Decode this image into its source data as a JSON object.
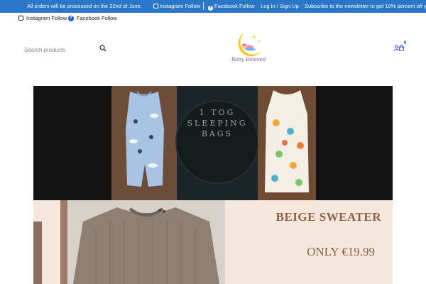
{
  "topbar": {
    "notice": "All orders will be processed on the 22nd of June.",
    "instagram_label": "Instagram Follow",
    "facebook_label": "Facebook Follow",
    "account_link": "Log In / Sign Up",
    "newsletter": "Subscribe to the newsletter to get 10% percent off yo",
    "bg_color": "#2a77c9"
  },
  "social": {
    "instagram_label": "Instagram Follow",
    "facebook_label": "Facebook Follow"
  },
  "header": {
    "search_placeholder": "Search products",
    "logo_text": "Baby Beloved",
    "cart_count": "0",
    "icons": [
      "search-icon",
      "user-icon",
      "cart-icon"
    ]
  },
  "banner_tog": {
    "lines": [
      "1 TOG",
      "SLEEPING",
      "BAGS"
    ]
  },
  "banner_sweater": {
    "title": "BEIGE SWEATER",
    "price": "ONLY €19.99",
    "accent_color": "#8a6048"
  }
}
